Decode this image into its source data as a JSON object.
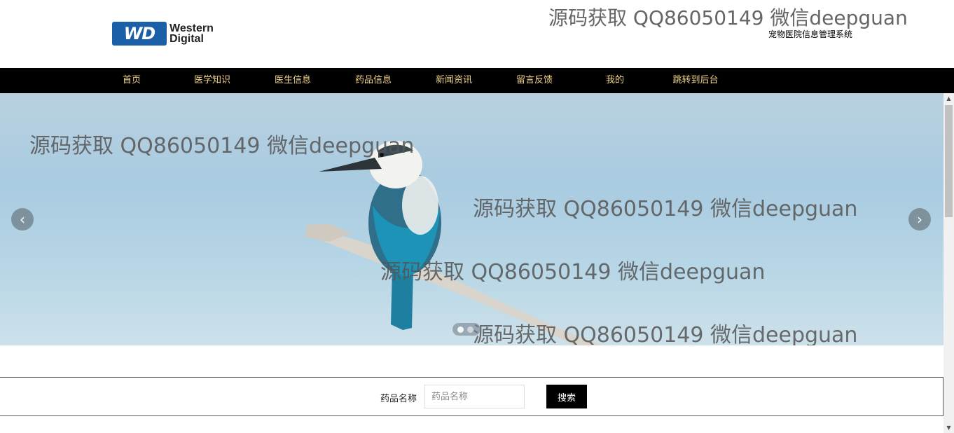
{
  "header": {
    "logo_badge": "WD",
    "logo_line1": "Western",
    "logo_line2": "Digital",
    "watermark": "源码获取 QQ86050149 微信deepguan",
    "site_subtitle": "宠物医院信息管理系统"
  },
  "nav": {
    "items": [
      {
        "label": "首页"
      },
      {
        "label": "医学知识"
      },
      {
        "label": "医生信息"
      },
      {
        "label": "药品信息"
      },
      {
        "label": "新闻资讯"
      },
      {
        "label": "留言反馈"
      },
      {
        "label": "我的"
      },
      {
        "label": "跳转到后台"
      }
    ],
    "text_color": "#f0d48a",
    "background": "#000000"
  },
  "banner": {
    "watermarks": [
      "源码获取 QQ86050149 微信deepguan",
      "源码获取 QQ86050149 微信deepguan",
      "源码获取 QQ86050149 微信deepguan",
      "源码获取 QQ86050149 微信deepguan"
    ],
    "prev_icon": "chevron-left-icon",
    "next_icon": "chevron-right-icon",
    "slide_count": 2,
    "active_slide": 1
  },
  "search": {
    "label": "药品名称",
    "placeholder": "药品名称",
    "value": "",
    "button_label": "搜索"
  }
}
